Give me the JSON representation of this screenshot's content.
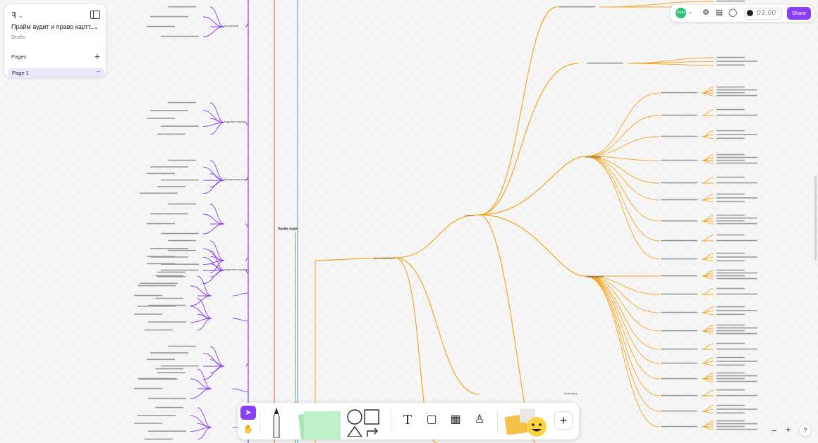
{
  "file": {
    "title": "Прайм аудит и право картт...",
    "subtitle": "Drafts"
  },
  "pages": {
    "label": "Pages",
    "items": [
      {
        "label": "Page 1"
      }
    ]
  },
  "topbar": {
    "avatar": "Dym",
    "timer": "03:00",
    "share_label": "Share"
  },
  "mindmap": {
    "center": "Прайм Аудит",
    "left_branches": [
      "Бухгалтерия",
      "Кадровые сервисы",
      "Юридические услуги",
      "Маркетинг и продажи"
    ],
    "right_hub": "Бухгалтерский учёт",
    "right_branches": [
      "Налоги",
      "Отчётность",
      "Консультации",
      "Сопровождение"
    ]
  },
  "colors": {
    "accent": "#8a3ffc",
    "branch_purple": "#8b3df0",
    "branch_orange": "#f5a623",
    "line_red": "#e25b4b",
    "line_blue": "#3aa0f0",
    "line_green": "#6aa84f"
  },
  "icons": {
    "menu": "figma-logo-icon",
    "sidebar": "sidebar-toggle-icon",
    "add_page": "plus-icon",
    "pen": "pen-icon",
    "sticky": "sticky-note-icon",
    "shapes": "shapes-icon",
    "text": "text-icon",
    "section": "section-icon",
    "table": "table-icon",
    "stamp": "stamp-icon",
    "stickers": "stickers-icon",
    "more": "plus-icon"
  },
  "zoom": {
    "out": "−",
    "in": "+",
    "help": "?"
  }
}
